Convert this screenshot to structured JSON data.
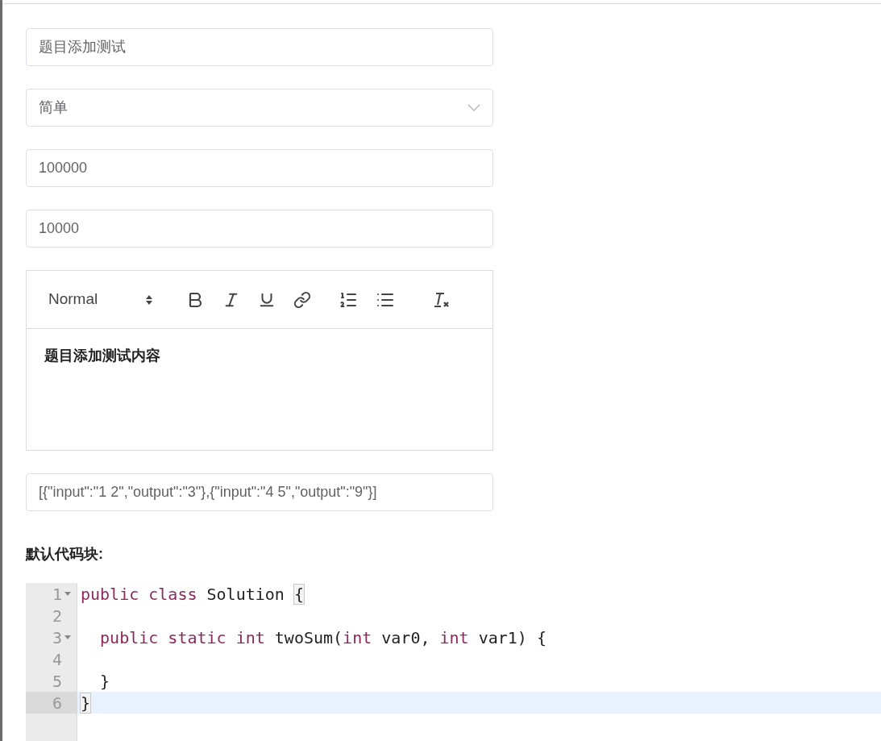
{
  "title_field": {
    "value": "题目添加测试"
  },
  "difficulty_select": {
    "value": "简单"
  },
  "time_limit_field": {
    "value": "100000"
  },
  "memory_limit_field": {
    "value": "10000"
  },
  "rich_editor": {
    "format": "Normal",
    "content": "题目添加测试内容"
  },
  "test_cases_field": {
    "value": "[{\"input\":\"1 2\",\"output\":\"3\"},{\"input\":\"4 5\",\"output\":\"9\"}]"
  },
  "code_section": {
    "label": "默认代码块:"
  },
  "code_lines": [
    {
      "number": "1",
      "foldable": true,
      "active": false,
      "tokens": [
        {
          "kind": "keyword",
          "text": "public class"
        },
        {
          "kind": "plain",
          "text": " Solution "
        },
        {
          "kind": "bracket",
          "text": "{"
        }
      ]
    },
    {
      "number": "2",
      "foldable": false,
      "active": false
    },
    {
      "number": "3",
      "foldable": true,
      "active": false,
      "tokens": [
        {
          "kind": "keyword",
          "text": "  public static int"
        },
        {
          "kind": "plain",
          "text": " twoSum("
        },
        {
          "kind": "keyword",
          "text": "int"
        },
        {
          "kind": "plain",
          "text": " var0, "
        },
        {
          "kind": "keyword",
          "text": "int"
        },
        {
          "kind": "plain",
          "text": " var1) {"
        }
      ]
    },
    {
      "number": "4",
      "foldable": false,
      "active": false
    },
    {
      "number": "5",
      "foldable": false,
      "active": false,
      "tokens": [
        {
          "kind": "plain",
          "text": "  }"
        }
      ]
    },
    {
      "number": "6",
      "foldable": false,
      "active": true,
      "tokens": [
        {
          "kind": "bracket",
          "text": "}"
        }
      ]
    }
  ]
}
